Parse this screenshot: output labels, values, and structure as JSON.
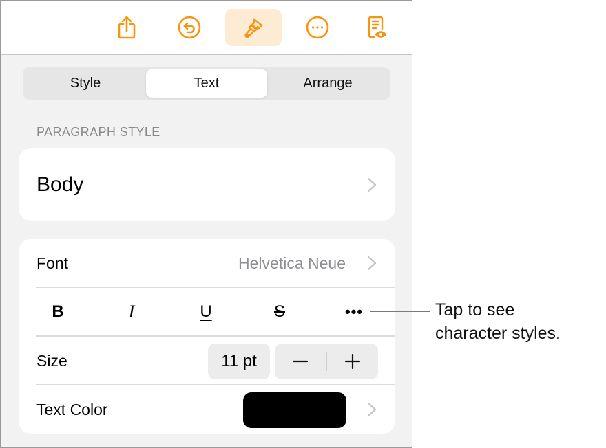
{
  "toolbar": {
    "buttons": [
      {
        "name": "share",
        "icon": "share-icon",
        "active": false
      },
      {
        "name": "undo",
        "icon": "undo-icon",
        "active": false
      },
      {
        "name": "format",
        "icon": "paintbrush-icon",
        "active": true
      },
      {
        "name": "more",
        "icon": "more-icon",
        "active": false
      },
      {
        "name": "reader-view",
        "icon": "document-view-icon",
        "active": false
      }
    ],
    "accent_color": "#f7950f",
    "active_bg_color": "#fdebd3"
  },
  "tabs": {
    "items": [
      "Style",
      "Text",
      "Arrange"
    ],
    "selected": "Text"
  },
  "paragraph_style": {
    "header": "PARAGRAPH STYLE",
    "value": "Body"
  },
  "font_row": {
    "label": "Font",
    "value": "Helvetica Neue"
  },
  "character_styles": {
    "bold": "B",
    "italic": "I",
    "underline": "U",
    "strikethrough": "S",
    "more": "•••"
  },
  "size_row": {
    "label": "Size",
    "value": "11 pt",
    "decrement": "minus-icon",
    "increment": "plus-icon"
  },
  "text_color_row": {
    "label": "Text Color",
    "swatch_color": "#000000"
  },
  "callout": {
    "text_line1": "Tap to see",
    "text_line2": "character styles."
  }
}
